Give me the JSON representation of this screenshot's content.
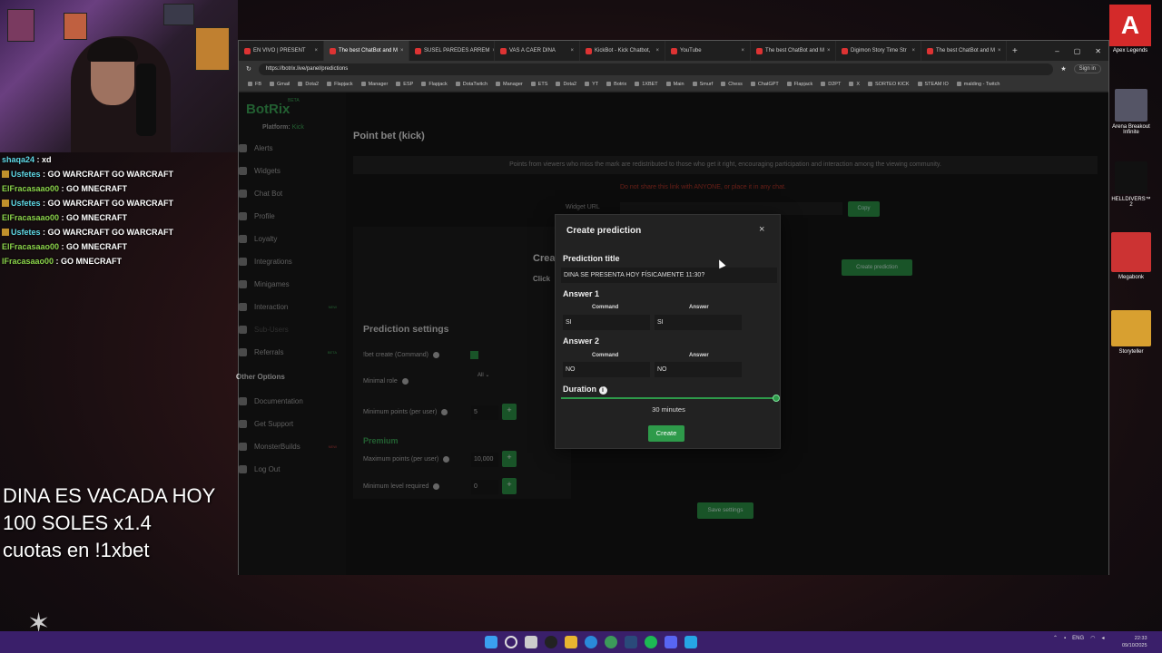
{
  "stream": {
    "overlay_lines": [
      "DINA ES VACADA HOY",
      "100 SOLES x1.4",
      "cuotas en !1xbet"
    ],
    "chat": [
      {
        "user": "shaqa24",
        "text": "xd",
        "color": "u1",
        "badge": false
      },
      {
        "user": "Usfetes",
        "text": "GO WARCRAFT GO WARCRAFT",
        "color": "u1",
        "badge": true
      },
      {
        "user": "ElFracasaao00",
        "text": "GO MNECRAFT",
        "color": "u2",
        "badge": false
      },
      {
        "user": "Usfetes",
        "text": "GO WARCRAFT GO WARCRAFT",
        "color": "u1",
        "badge": true
      },
      {
        "user": "ElFracasaao00",
        "text": "GO MNECRAFT",
        "color": "u2",
        "badge": false
      },
      {
        "user": "Usfetes",
        "text": "GO WARCRAFT GO WARCRAFT",
        "color": "u1",
        "badge": true
      },
      {
        "user": "ElFracasaao00",
        "text": "GO MNECRAFT",
        "color": "u2",
        "badge": false
      },
      {
        "user": "lFracasaao00",
        "text": "GO MNECRAFT",
        "color": "u2",
        "badge": false
      }
    ]
  },
  "desktop": {
    "icons": [
      "Apex Legends",
      "Arena Breakout Infinite",
      "HELLDIVERS™ 2",
      "Megabonk",
      "Storyteller"
    ]
  },
  "browser": {
    "tabs": [
      {
        "label": "EN VIVO | PRESENT",
        "active": false
      },
      {
        "label": "The best ChatBot and M",
        "active": true
      },
      {
        "label": "SUSEL PAREDES ARREM",
        "active": false
      },
      {
        "label": "VAS A CAER DINA",
        "active": false
      },
      {
        "label": "KickBot - Kick Chatbot,",
        "active": false
      },
      {
        "label": "YouTube",
        "active": false
      },
      {
        "label": "The best ChatBot and M",
        "active": false
      },
      {
        "label": "Digimon Story Time Str",
        "active": false
      },
      {
        "label": "The best ChatBot and M",
        "active": false
      }
    ],
    "url": "https://botrix.live/panel/predictions",
    "sign_in": "Sign in",
    "bookmarks": [
      "FB",
      "Gmail",
      "Dota2",
      "Flapjack",
      "Manager",
      "ESP",
      "Flapjack",
      "DotaTwitch",
      "Manager",
      "ETS",
      "Dota2",
      "YT",
      "Botrix",
      "1XBET",
      "Main",
      "Smurf",
      "Chess",
      "ChatGPT",
      "Flapjack",
      "D2PT",
      "X",
      "SORTEO KICK",
      "STEAM IO",
      "malding - Twitch"
    ]
  },
  "sidebar": {
    "brand": "BotRix",
    "beta": "BETA",
    "platform_label": "Platform:",
    "platform_value": "Kick",
    "items": [
      {
        "label": "Alerts",
        "muted": false,
        "tag": ""
      },
      {
        "label": "Widgets",
        "muted": false,
        "tag": ""
      },
      {
        "label": "Chat Bot",
        "muted": false,
        "tag": ""
      },
      {
        "label": "Profile",
        "muted": false,
        "tag": ""
      },
      {
        "label": "Loyalty",
        "muted": false,
        "tag": ""
      },
      {
        "label": "Integrations",
        "muted": false,
        "tag": ""
      },
      {
        "label": "Minigames",
        "muted": false,
        "tag": ""
      },
      {
        "label": "Interaction",
        "muted": false,
        "tag": "NEW"
      },
      {
        "label": "Sub-Users",
        "muted": true,
        "tag": ""
      },
      {
        "label": "Referrals",
        "muted": false,
        "tag": "BETA"
      }
    ],
    "other_title": "Other Options",
    "other_items": [
      {
        "label": "Documentation",
        "tag": ""
      },
      {
        "label": "Get Support",
        "tag": ""
      },
      {
        "label": "MonsterBuilds",
        "tag": "NEW"
      },
      {
        "label": "Log Out",
        "tag": ""
      }
    ]
  },
  "content": {
    "title": "Point bet (kick)",
    "banner": "Points from viewers who miss the mark are redistributed to those who get it right, encouraging participation and interaction among the viewing community.",
    "warning": "Do not share this link with ANYONE, or place it in any chat.",
    "widget_url_label": "Widget URL",
    "copy": "Copy",
    "create_heading": "Crea",
    "click_text": "Click",
    "create_prediction_btn": "Create prediction",
    "settings_title": "Prediction settings",
    "bet_create_label": "!bet create (Command)",
    "minimal_role_label": "Minimal role",
    "minimal_role_value": "All",
    "min_points_label": "Minimum points (per user)",
    "min_points_value": "5",
    "premium": "Premium",
    "max_points_label": "Maximum points (per user)",
    "max_points_value": "10,000",
    "min_level_label": "Minimum level required",
    "min_level_value": "0",
    "save": "Save settings"
  },
  "modal": {
    "title": "Create prediction",
    "close": "×",
    "prediction_title_label": "Prediction title",
    "prediction_title_value": "DINA SE PRESENTA HOY FÍSICAMENTE 11:30?",
    "answer1_label": "Answer 1",
    "answer2_label": "Answer 2",
    "command_col": "Command",
    "answer_col": "Answer",
    "a1_command": "SI",
    "a1_answer": "SI",
    "a2_command": "NO",
    "a2_answer": "NO",
    "duration_label": "Duration",
    "duration_fraction": 1.0,
    "duration_value": "30 minutes",
    "create": "Create"
  },
  "taskbar": {
    "lang": "ENG",
    "time": "22:33",
    "date": "09/10/2025"
  },
  "colors": {
    "accent": "#2e9a4a",
    "taskbar": "#3a1f6a"
  }
}
